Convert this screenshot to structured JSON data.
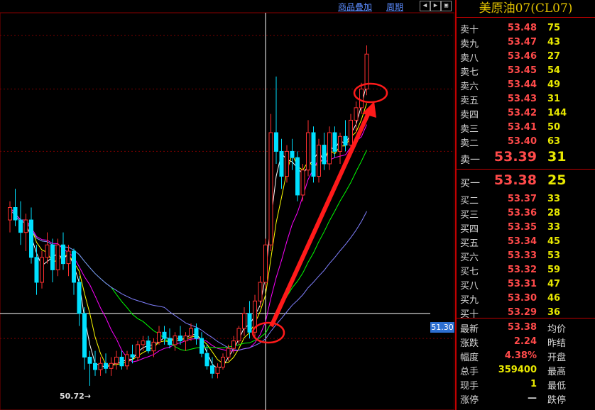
{
  "toolbar": {
    "overlay_label": "商品叠加",
    "period_label": "周期",
    "nav_icons": [
      "arrow-left-icon",
      "arrow-right-icon",
      "toggle-icon"
    ]
  },
  "panel": {
    "title": "美原油07(CL07)",
    "asks": [
      {
        "label": "卖十",
        "price": "53.48",
        "vol": "75"
      },
      {
        "label": "卖九",
        "price": "53.47",
        "vol": "43"
      },
      {
        "label": "卖八",
        "price": "53.46",
        "vol": "27"
      },
      {
        "label": "卖七",
        "price": "53.45",
        "vol": "54"
      },
      {
        "label": "卖六",
        "price": "53.44",
        "vol": "49"
      },
      {
        "label": "卖五",
        "price": "53.43",
        "vol": "31"
      },
      {
        "label": "卖四",
        "price": "53.42",
        "vol": "144"
      },
      {
        "label": "卖三",
        "price": "53.41",
        "vol": "50"
      },
      {
        "label": "卖二",
        "price": "53.40",
        "vol": "63"
      },
      {
        "label": "卖一",
        "price": "53.39",
        "vol": "31"
      }
    ],
    "bids": [
      {
        "label": "买一",
        "price": "53.38",
        "vol": "25"
      },
      {
        "label": "买二",
        "price": "53.37",
        "vol": "33"
      },
      {
        "label": "买三",
        "price": "53.36",
        "vol": "28"
      },
      {
        "label": "买四",
        "price": "53.35",
        "vol": "33"
      },
      {
        "label": "买五",
        "price": "53.34",
        "vol": "45"
      },
      {
        "label": "买六",
        "price": "53.33",
        "vol": "53"
      },
      {
        "label": "买七",
        "price": "53.32",
        "vol": "59"
      },
      {
        "label": "买八",
        "price": "53.31",
        "vol": "47"
      },
      {
        "label": "买九",
        "price": "53.30",
        "vol": "46"
      },
      {
        "label": "买十",
        "price": "53.29",
        "vol": "36"
      }
    ],
    "stats": [
      {
        "k1": "最新",
        "v1": "53.38",
        "c1": "#ff4a4a",
        "k2": "均价"
      },
      {
        "k1": "涨跌",
        "v1": "2.24",
        "c1": "#ff4a4a",
        "k2": "昨结"
      },
      {
        "k1": "幅度",
        "v1": "4.38%",
        "c1": "#ff4a4a",
        "k2": "开盘"
      },
      {
        "k1": "总手",
        "v1": "359400",
        "c1": "#e8e800",
        "k2": "最高"
      },
      {
        "k1": "现手",
        "v1": "1",
        "c1": "#e8e800",
        "k2": "最低"
      },
      {
        "k1": "涨停",
        "v1": "—",
        "c1": "#d8d8d8",
        "k2": "跌停"
      }
    ]
  },
  "chart_data": {
    "type": "candlestick",
    "crosshair_price": "51.30",
    "low_label": "50.72",
    "ylim": [
      50.6,
      53.7
    ],
    "up_color": "#ff3030",
    "down_color": "#00e0ff",
    "ma_colors": [
      "#ffffff",
      "#ffff00",
      "#ff00ff",
      "#00ff00",
      "#8080ff"
    ],
    "candles": [
      [
        52.05,
        52.2,
        51.95,
        52.15
      ],
      [
        52.15,
        52.3,
        52.0,
        52.05
      ],
      [
        52.05,
        52.2,
        51.85,
        51.95
      ],
      [
        51.95,
        52.1,
        51.8,
        52.05
      ],
      [
        52.05,
        52.15,
        51.7,
        51.75
      ],
      [
        51.75,
        51.85,
        51.45,
        51.55
      ],
      [
        51.55,
        51.8,
        51.5,
        51.75
      ],
      [
        51.75,
        51.95,
        51.7,
        51.85
      ],
      [
        51.85,
        51.9,
        51.55,
        51.65
      ],
      [
        51.65,
        51.9,
        51.6,
        51.85
      ],
      [
        51.85,
        51.95,
        51.65,
        51.7
      ],
      [
        51.7,
        51.85,
        51.6,
        51.8
      ],
      [
        51.8,
        51.82,
        51.45,
        51.55
      ],
      [
        51.55,
        51.6,
        51.2,
        51.3
      ],
      [
        51.3,
        51.35,
        50.85,
        50.95
      ],
      [
        50.95,
        51.0,
        50.72,
        50.9
      ],
      [
        50.9,
        51.0,
        50.8,
        50.85
      ],
      [
        50.85,
        50.95,
        50.8,
        50.9
      ],
      [
        50.9,
        50.98,
        50.82,
        50.86
      ],
      [
        50.86,
        50.95,
        50.8,
        50.9
      ],
      [
        50.9,
        51.0,
        50.85,
        50.95
      ],
      [
        50.95,
        51.0,
        50.85,
        50.88
      ],
      [
        50.88,
        51.0,
        50.85,
        50.97
      ],
      [
        50.97,
        51.05,
        50.9,
        50.95
      ],
      [
        50.95,
        51.08,
        50.92,
        51.05
      ],
      [
        51.05,
        51.12,
        51.0,
        51.08
      ],
      [
        51.08,
        51.12,
        50.98,
        51.0
      ],
      [
        51.0,
        51.1,
        50.95,
        51.07
      ],
      [
        51.07,
        51.2,
        51.05,
        51.15
      ],
      [
        51.15,
        51.2,
        51.05,
        51.1
      ],
      [
        51.1,
        51.18,
        51.02,
        51.05
      ],
      [
        51.05,
        51.15,
        51.0,
        51.12
      ],
      [
        51.12,
        51.2,
        51.05,
        51.08
      ],
      [
        51.08,
        51.15,
        51.0,
        51.12
      ],
      [
        51.12,
        51.22,
        51.08,
        51.18
      ],
      [
        51.18,
        51.22,
        51.05,
        51.1
      ],
      [
        51.1,
        51.15,
        50.95,
        50.98
      ],
      [
        50.98,
        51.05,
        50.85,
        50.88
      ],
      [
        50.88,
        50.95,
        50.78,
        50.82
      ],
      [
        50.82,
        50.9,
        50.78,
        50.87
      ],
      [
        50.87,
        50.98,
        50.85,
        50.95
      ],
      [
        50.95,
        51.05,
        50.92,
        51.02
      ],
      [
        51.02,
        51.12,
        50.98,
        51.08
      ],
      [
        51.08,
        51.2,
        51.05,
        51.18
      ],
      [
        51.18,
        51.35,
        51.12,
        51.3
      ],
      [
        51.3,
        51.4,
        51.1,
        51.15
      ],
      [
        51.15,
        51.45,
        51.1,
        51.4
      ],
      [
        51.4,
        51.6,
        51.35,
        51.55
      ],
      [
        51.55,
        51.9,
        51.5,
        51.85
      ],
      [
        51.85,
        52.9,
        51.8,
        52.75
      ],
      [
        52.75,
        53.2,
        52.5,
        52.6
      ],
      [
        52.6,
        52.7,
        52.3,
        52.4
      ],
      [
        52.4,
        52.65,
        52.35,
        52.6
      ],
      [
        52.6,
        52.7,
        52.45,
        52.55
      ],
      [
        52.55,
        52.6,
        52.2,
        52.25
      ],
      [
        52.25,
        52.5,
        52.2,
        52.45
      ],
      [
        52.45,
        52.85,
        52.4,
        52.75
      ],
      [
        52.75,
        52.8,
        52.35,
        52.4
      ],
      [
        52.4,
        52.7,
        52.35,
        52.65
      ],
      [
        52.65,
        52.75,
        52.45,
        52.5
      ],
      [
        52.5,
        52.8,
        52.45,
        52.75
      ],
      [
        52.75,
        52.8,
        52.55,
        52.6
      ],
      [
        52.6,
        52.75,
        52.5,
        52.72
      ],
      [
        52.72,
        52.85,
        52.6,
        52.65
      ],
      [
        52.65,
        52.9,
        52.6,
        52.85
      ],
      [
        52.85,
        53.0,
        52.75,
        52.95
      ],
      [
        52.95,
        53.15,
        52.9,
        53.1
      ],
      [
        53.1,
        53.45,
        53.05,
        53.38
      ]
    ]
  }
}
